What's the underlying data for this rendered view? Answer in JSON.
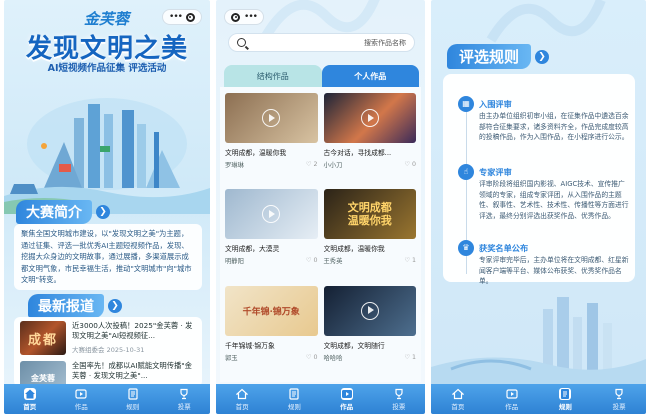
{
  "screen1": {
    "logo_text": "金芙蓉",
    "title": "发现文明之美",
    "subtitle": "AI短视频作品征集 评选活动",
    "intro": {
      "heading": "大赛简介",
      "text": "聚焦全国文明城市建设，以\"发现文明之美\"为主题，通过征集、评选一批优秀AI主题短视频作品，发现、挖掘大众身边的文明故事，通过展播，多渠道展示成都文明气象，市民幸福生活，推动\"文明城市\"向\"城市文明\"转变。"
    },
    "news": {
      "heading": "最新报道",
      "items": [
        {
          "thumb_text": "成都",
          "title": "近3000人次投稿！2025\"金芙蓉 · 发现文明之美\"AI短视频征...",
          "date": "大赛组委会 2025-10-31"
        },
        {
          "thumb_text": "金芙蓉",
          "title": "全国率先！成都以AI赋能文明传播\"金芙蓉 · 发现文明之美\"...",
          "date": ""
        }
      ]
    }
  },
  "screen2": {
    "search_placeholder": "搜索作品名称",
    "tabs": [
      "结构作品",
      "个人作品"
    ],
    "works": [
      {
        "title": "古今对话，寻找成都...",
        "author": "小小刀",
        "likes": "♡ 0",
        "colors": [
          "#1c2438",
          "#d2774a"
        ],
        "overlay": ""
      },
      {
        "title": "文明成都，温暖你我",
        "author": "罗琳琳",
        "likes": "♡ 2",
        "colors": [
          "#8c6f52",
          "#d8c3a2"
        ],
        "overlay": ""
      },
      {
        "title": "文明成都，温暖你我",
        "author": "王秀英",
        "likes": "♡ 1",
        "colors": [
          "#2b2318",
          "#9a7630"
        ],
        "overlay": "文明成都\n温暖你我"
      },
      {
        "title": "文明成都，大漠灵",
        "author": "明静阳",
        "likes": "♡ 0",
        "colors": [
          "#9fb8cf",
          "#e6eef5"
        ],
        "overlay": ""
      },
      {
        "title": "文明成都，文明随行",
        "author": "哈哈哈",
        "likes": "♡ 1",
        "colors": [
          "#142033",
          "#4e6f8f"
        ],
        "overlay": ""
      },
      {
        "title": "千年锦城·锦万象",
        "author": "郭玉",
        "likes": "♡ 0",
        "colors": [
          "#f1e4c8",
          "#e8c98f"
        ],
        "overlay": "千年锦·锦万象"
      }
    ]
  },
  "screen3": {
    "heading": "评选规则",
    "sections": [
      {
        "icon": "▦",
        "title": "入围评审",
        "body": "由主办单位组织初审小组，在征集作品中遴选百余部符合征集要求，诸多资料齐全，作品完成度较高的投稿作品，作为入围作品，在小程序进行公示。"
      },
      {
        "icon": "☝",
        "title": "专家评审",
        "body": "评审阶段将组织国内影视、AIGC技术、宣传推广领域的专家，组成专家评团，从入围作品的主题性、叙事性、艺术性、技术性、传播性等方面进行评选，最终分别评选出获奖作品、优秀作品。"
      },
      {
        "icon": "♛",
        "title": "获奖名单公布",
        "body": "专家评审完毕后，主办单位将在文明成都、红星新闻客户端等平台、媒体公布获奖、优秀奖作品名单。"
      }
    ]
  },
  "tabbars": {
    "screen1": [
      "首页",
      "作品",
      "规则",
      "投票"
    ],
    "screen2": [
      "首页",
      "规则",
      "作品",
      "投票"
    ],
    "screen3": [
      "首页",
      "作品",
      "规则",
      "投票"
    ]
  },
  "colors": {
    "primary": "#2f86dd",
    "title_blue": "#1565c0",
    "teal_tab": "#b8e4e6"
  }
}
